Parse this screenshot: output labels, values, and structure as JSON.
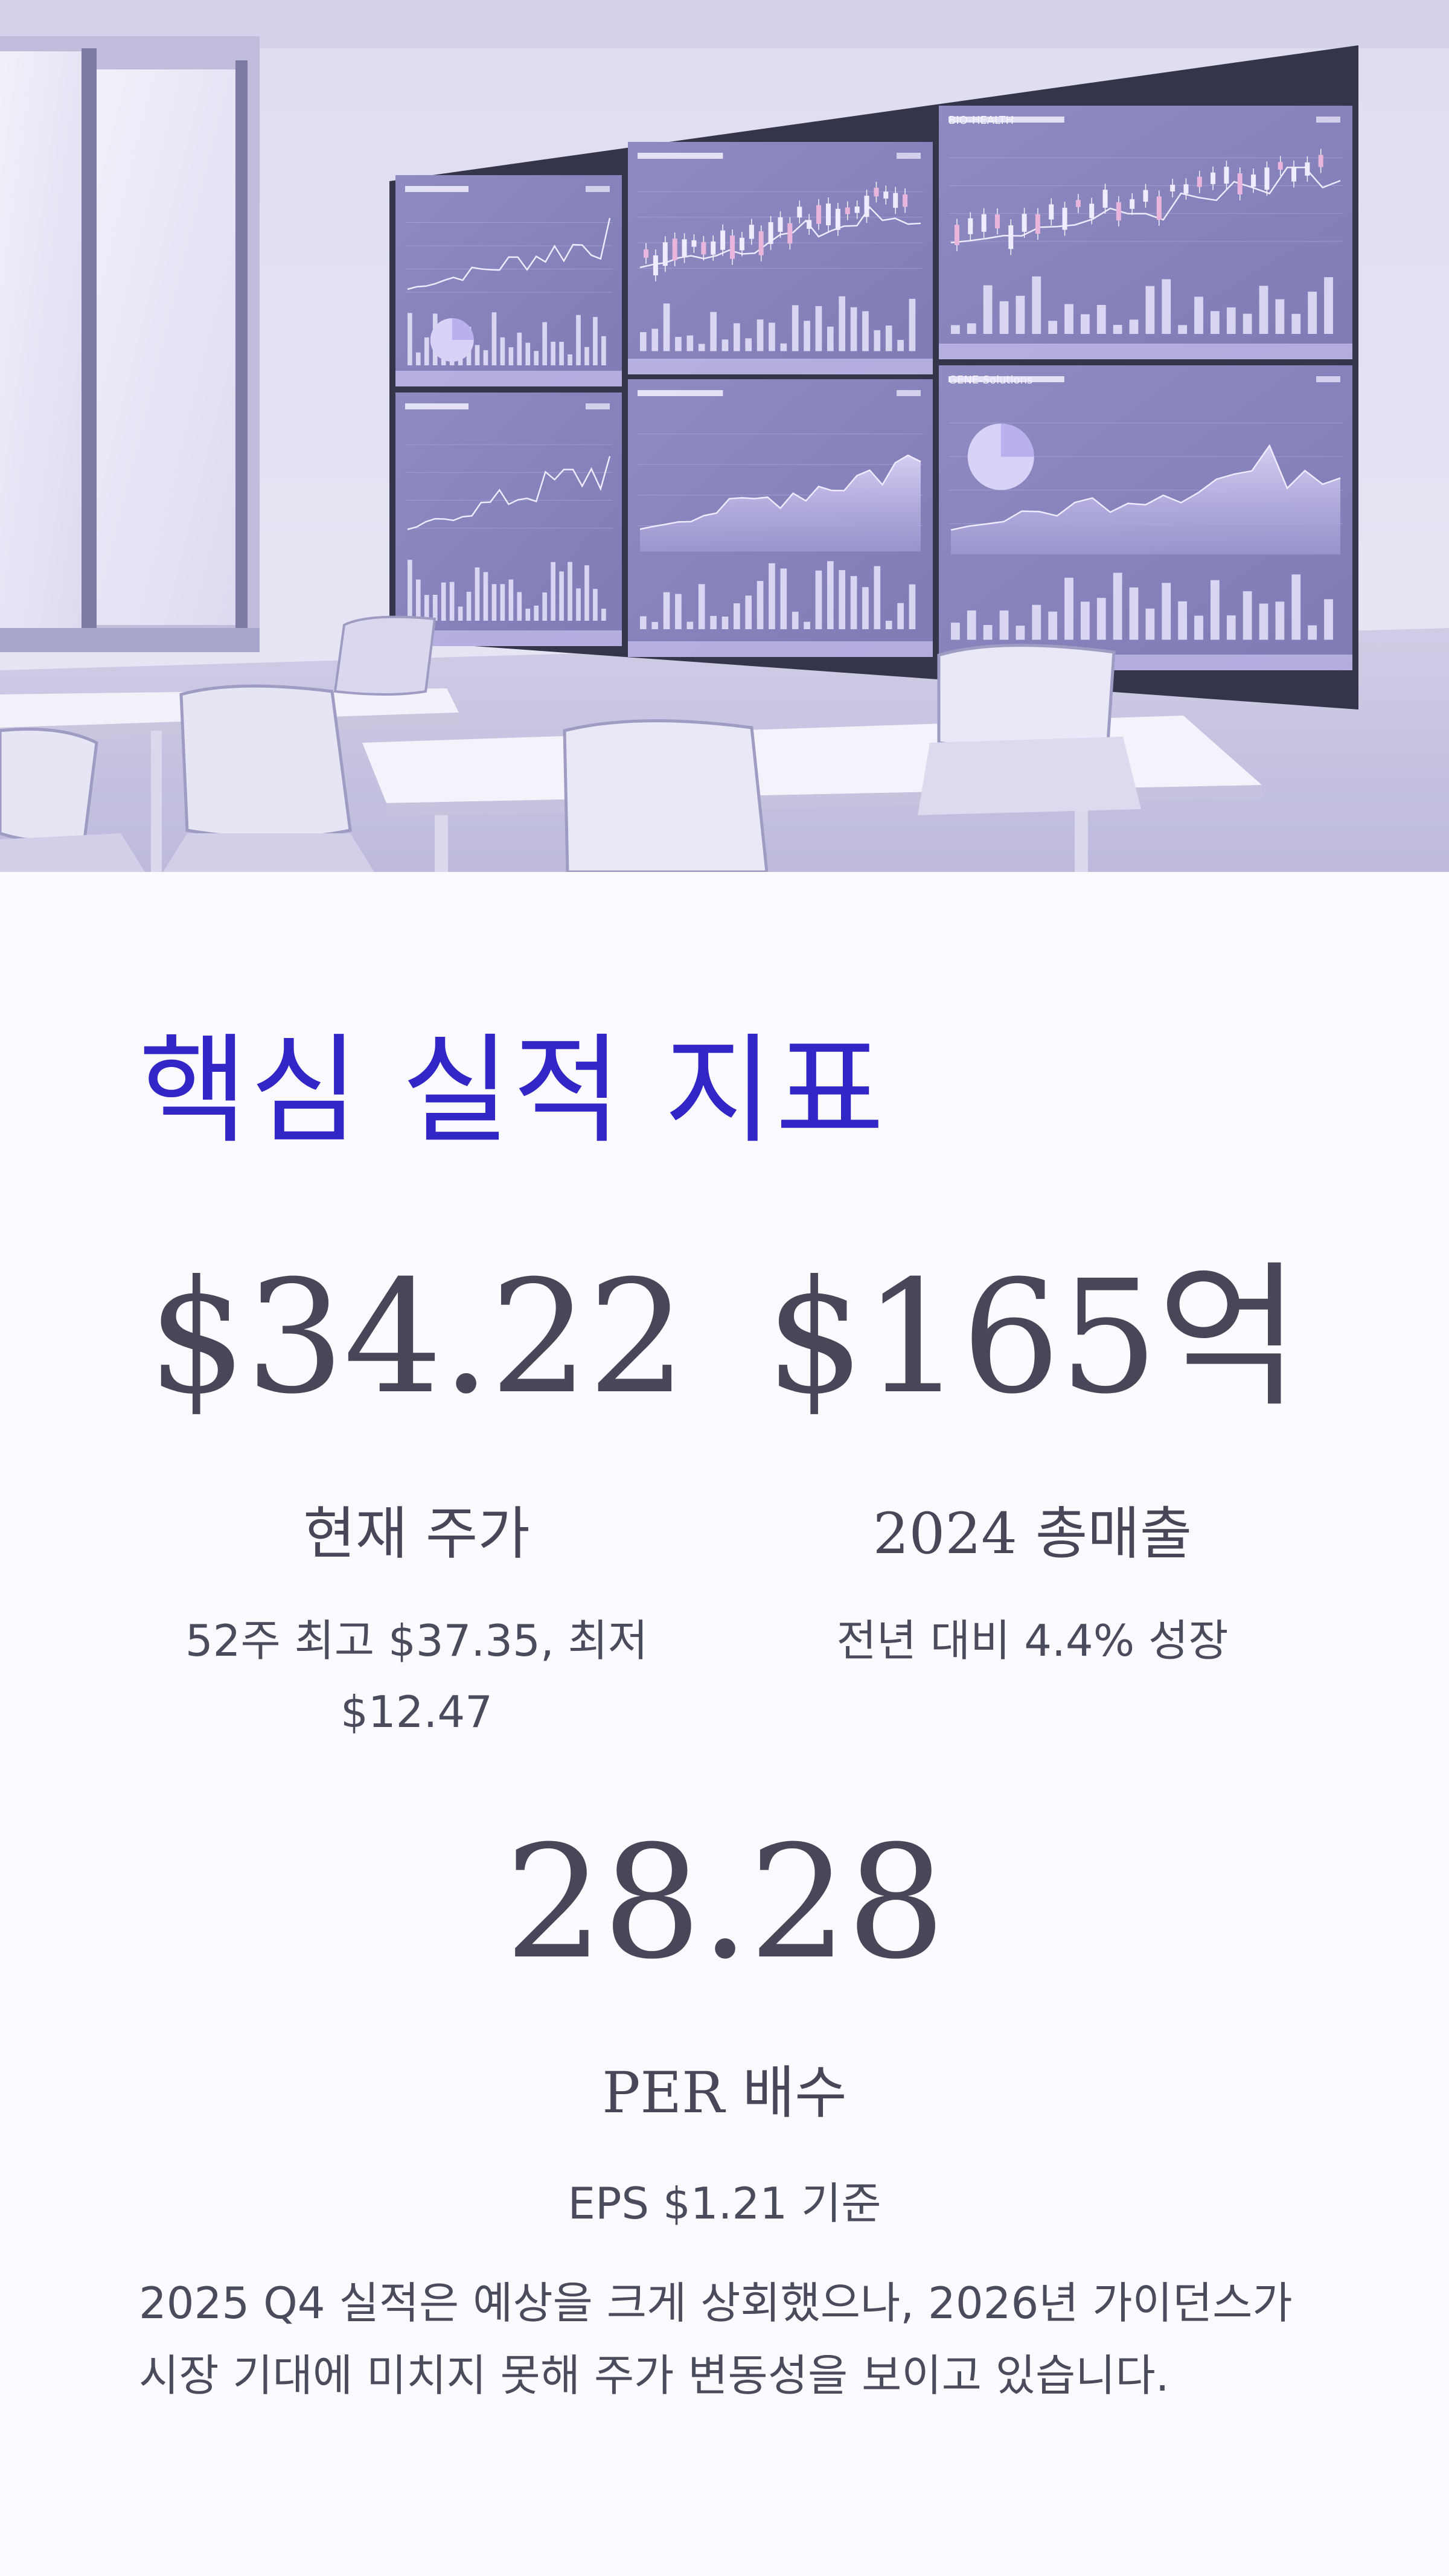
{
  "hero": {
    "image": "office-meeting-room-with-stock-dashboard-wall",
    "screens": [
      {
        "title": "",
        "tag": ""
      },
      {
        "title": "",
        "tag": ""
      },
      {
        "title": "BIO-HEALTH",
        "tag": ""
      },
      {
        "title": "",
        "tag": ""
      },
      {
        "title": "",
        "tag": ""
      },
      {
        "title": "GENE-Solutions",
        "tag": ""
      }
    ],
    "colors": {
      "screen": "#8d8ac0",
      "wall": "#e3e2f2",
      "accent": "#cbc3ef"
    }
  },
  "section": {
    "title": "핵심 실적 지표"
  },
  "metrics": {
    "price": {
      "value": "$34.22",
      "label": "현재 주가",
      "sub": "52주 최고 $37.35, 최저 $12.47"
    },
    "revenue": {
      "value": "$165억",
      "label": "2024 총매출",
      "sub": "전년 대비 4.4% 성장"
    },
    "per": {
      "value": "28.28",
      "label": "PER 배수",
      "sub": "EPS $1.21 기준"
    }
  },
  "summary": {
    "text": "2025 Q4 실적은 예상을 크게 상회했으나, 2026년 가이던스가 시장 기대에 미치지 못해 주가 변동성을 보이고 있습니다."
  },
  "colors": {
    "title": "#3326c6",
    "text": "#474759",
    "background": "#fbfbff"
  }
}
